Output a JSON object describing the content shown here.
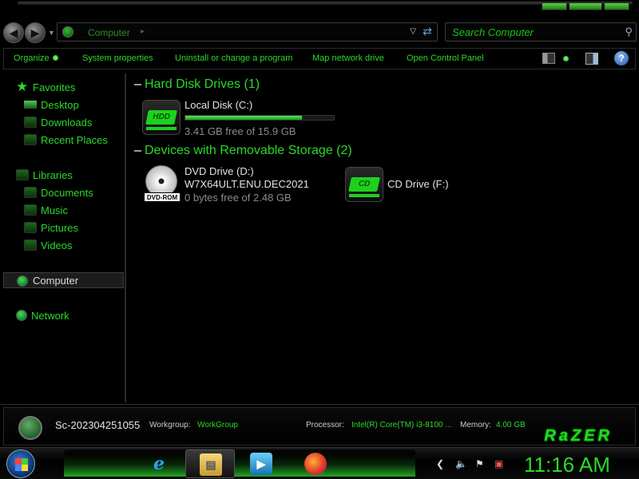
{
  "address_bar": {
    "breadcrumb": "Computer",
    "search_placeholder": "Search Computer"
  },
  "command_bar": {
    "organize": "Organize",
    "system_properties": "System properties",
    "uninstall": "Uninstall or change a program",
    "map_network": "Map network drive",
    "control_panel": "Open Control Panel",
    "help": "?"
  },
  "navigation": {
    "favorites": "Favorites",
    "favorites_items": [
      "Desktop",
      "Downloads",
      "Recent Places"
    ],
    "libraries": "Libraries",
    "libraries_items": [
      "Documents",
      "Music",
      "Pictures",
      "Videos"
    ],
    "computer": "Computer",
    "network": "Network"
  },
  "content": {
    "hdd_group": "Hard Disk Drives (1)",
    "local_disk": {
      "name": "Local Disk (C:)",
      "free": "3.41 GB free of 15.9 GB",
      "icon_label": "HDD",
      "used_fraction": 0.785
    },
    "removable_group": "Devices with Removable Storage (2)",
    "dvd": {
      "name": "DVD Drive (D:)",
      "volume": "W7X64ULT.ENU.DEC2021",
      "free": "0 bytes free of 2.48 GB",
      "icon_label": "DVD-ROM"
    },
    "cd": {
      "name": "CD Drive (F:)",
      "icon_label": "CD"
    }
  },
  "details": {
    "computer_name": "Sc-202304251055",
    "workgroup_label": "Workgroup:",
    "workgroup_value": "WorkGroup",
    "processor_label": "Processor:",
    "processor_value": "Intel(R) Core(TM) i3-8100 ...",
    "memory_label": "Memory:",
    "memory_value": "4.00 GB",
    "brand": "RaZER"
  },
  "taskbar": {
    "clock": "11:16 AM",
    "apps": [
      "internet-explorer-icon",
      "windows-explorer-icon",
      "media-player-icon",
      "firefox-icon"
    ]
  },
  "colors": {
    "accent": "#2bd92b",
    "background": "#000000"
  }
}
